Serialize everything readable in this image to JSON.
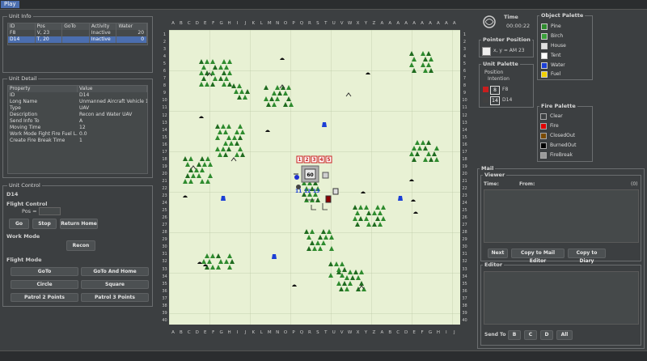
{
  "menu": {
    "play": "Play"
  },
  "unit_info": {
    "title": "Unit Info",
    "columns": [
      "ID",
      "Pos",
      "GoTo",
      "Activity",
      "Water"
    ],
    "rows": [
      [
        "F8",
        "V, 23",
        "",
        "Inactive",
        "20"
      ],
      [
        "D14",
        "T, 20",
        "",
        "Inactive",
        "0"
      ]
    ],
    "selected_row": 1
  },
  "unit_detail": {
    "title": "Unit Detail",
    "columns": [
      "Property",
      "Value"
    ],
    "rows": [
      [
        "ID",
        "D14"
      ],
      [
        "Long Name",
        "Unmanned Aircraft Vehicle 14"
      ],
      [
        "Type",
        "UAV"
      ],
      [
        "Description",
        "Recon and Water UAV"
      ],
      [
        "Send Info To",
        "A"
      ],
      [
        "Moving Time",
        "12"
      ],
      [
        "Work Mode Fight Fire Fuel L...",
        "0.0"
      ],
      [
        "Create Fire Break Time",
        "1"
      ]
    ]
  },
  "unit_control": {
    "title": "Unit Control",
    "unit_id": "D14",
    "flight_control_label": "Flight Control",
    "pos_label": "Pos =",
    "pos_value": "",
    "go": "Go",
    "stop": "Stop",
    "return_home": "Return Home",
    "work_mode_label": "Work Mode",
    "recon": "Recon",
    "flight_mode_label": "Flight Mode",
    "goto": "GoTo",
    "goto_and_home": "GoTo And Home",
    "circle": "Circle",
    "square": "Square",
    "patrol2": "Patrol 2 Points",
    "patrol3": "Patrol 3 Points"
  },
  "map": {
    "col_labels_top": [
      "A",
      "B",
      "C",
      "D",
      "E",
      "F",
      "G",
      "H",
      "I",
      "J",
      "K",
      "L",
      "M",
      "N",
      "O",
      "P",
      "Q",
      "R",
      "S",
      "T",
      "U",
      "V",
      "W",
      "X",
      "Y",
      "Z",
      "A",
      "A",
      "A",
      "A",
      "A",
      "A",
      "A",
      "A",
      "A",
      "A"
    ],
    "col_labels_bottom": [
      "A",
      "B",
      "C",
      "D",
      "E",
      "F",
      "G",
      "H",
      "I",
      "J",
      "K",
      "L",
      "M",
      "N",
      "O",
      "P",
      "Q",
      "R",
      "S",
      "T",
      "U",
      "V",
      "W",
      "X",
      "Y",
      "Z",
      "A",
      "B",
      "C",
      "D",
      "E",
      "F",
      "G",
      "H",
      "I",
      "J"
    ],
    "row_labels": [
      "1",
      "2",
      "3",
      "4",
      "5",
      "6",
      "7",
      "8",
      "9",
      "10",
      "11",
      "12",
      "13",
      "14",
      "15",
      "16",
      "17",
      "18",
      "19",
      "20",
      "21",
      "22",
      "23",
      "24",
      "25",
      "26",
      "27",
      "28",
      "29",
      "30",
      "31",
      "32",
      "33",
      "34",
      "35",
      "36",
      "37",
      "38",
      "39",
      "40"
    ],
    "unit_markers": [
      "1",
      "2",
      "3",
      "4",
      "5"
    ],
    "base_number": "60",
    "base_labels": [
      "11",
      "12",
      "13"
    ]
  },
  "time": {
    "label": "Time",
    "value": "00:00:22"
  },
  "pointer_position": {
    "label": "Pointer Position",
    "value": "x, y = AM 23"
  },
  "unit_palette": {
    "title": "Unit Palette",
    "position": "Position",
    "intention": "Intention",
    "units": [
      {
        "num": "8",
        "id": "F8",
        "color": "#c81e1e"
      },
      {
        "num": "14",
        "id": "D14",
        "color": "#404040"
      }
    ]
  },
  "object_palette": {
    "title": "Object Palette",
    "items": [
      {
        "icon": "pine-icon",
        "label": "Pine",
        "color": "#2e8b2e"
      },
      {
        "icon": "birch-icon",
        "label": "Birch",
        "color": "#3aa03a"
      },
      {
        "icon": "house-icon",
        "label": "House",
        "color": "#e0e0e0"
      },
      {
        "icon": "tent-icon",
        "label": "Tent",
        "color": "#ffffff"
      },
      {
        "icon": "water-icon",
        "label": "Water",
        "color": "#1c3fd6"
      },
      {
        "icon": "fuel-icon",
        "label": "Fuel",
        "color": "#f0d000"
      }
    ]
  },
  "fire_palette": {
    "title": "Fire Palette",
    "items": [
      {
        "label": "Clear",
        "color": "#3c3f41"
      },
      {
        "label": "Fire",
        "color": "#e00000"
      },
      {
        "label": "ClosedOut",
        "color": "#7a4a00"
      },
      {
        "label": "BurnedOut",
        "color": "#000000"
      },
      {
        "label": "FireBreak",
        "color": "#9a9a9a"
      }
    ]
  },
  "mail": {
    "title": "Mail",
    "viewer_label": "Viewer",
    "time_label": "Time:",
    "from_label": "From:",
    "count": "(0)",
    "next": "Next",
    "copy_mail_editor": "Copy to Mail Editor",
    "copy_diary": "Copy to Diary",
    "editor_label": "Editor",
    "send_to": "Send To",
    "recipients": [
      "B",
      "C",
      "D",
      "All"
    ]
  }
}
